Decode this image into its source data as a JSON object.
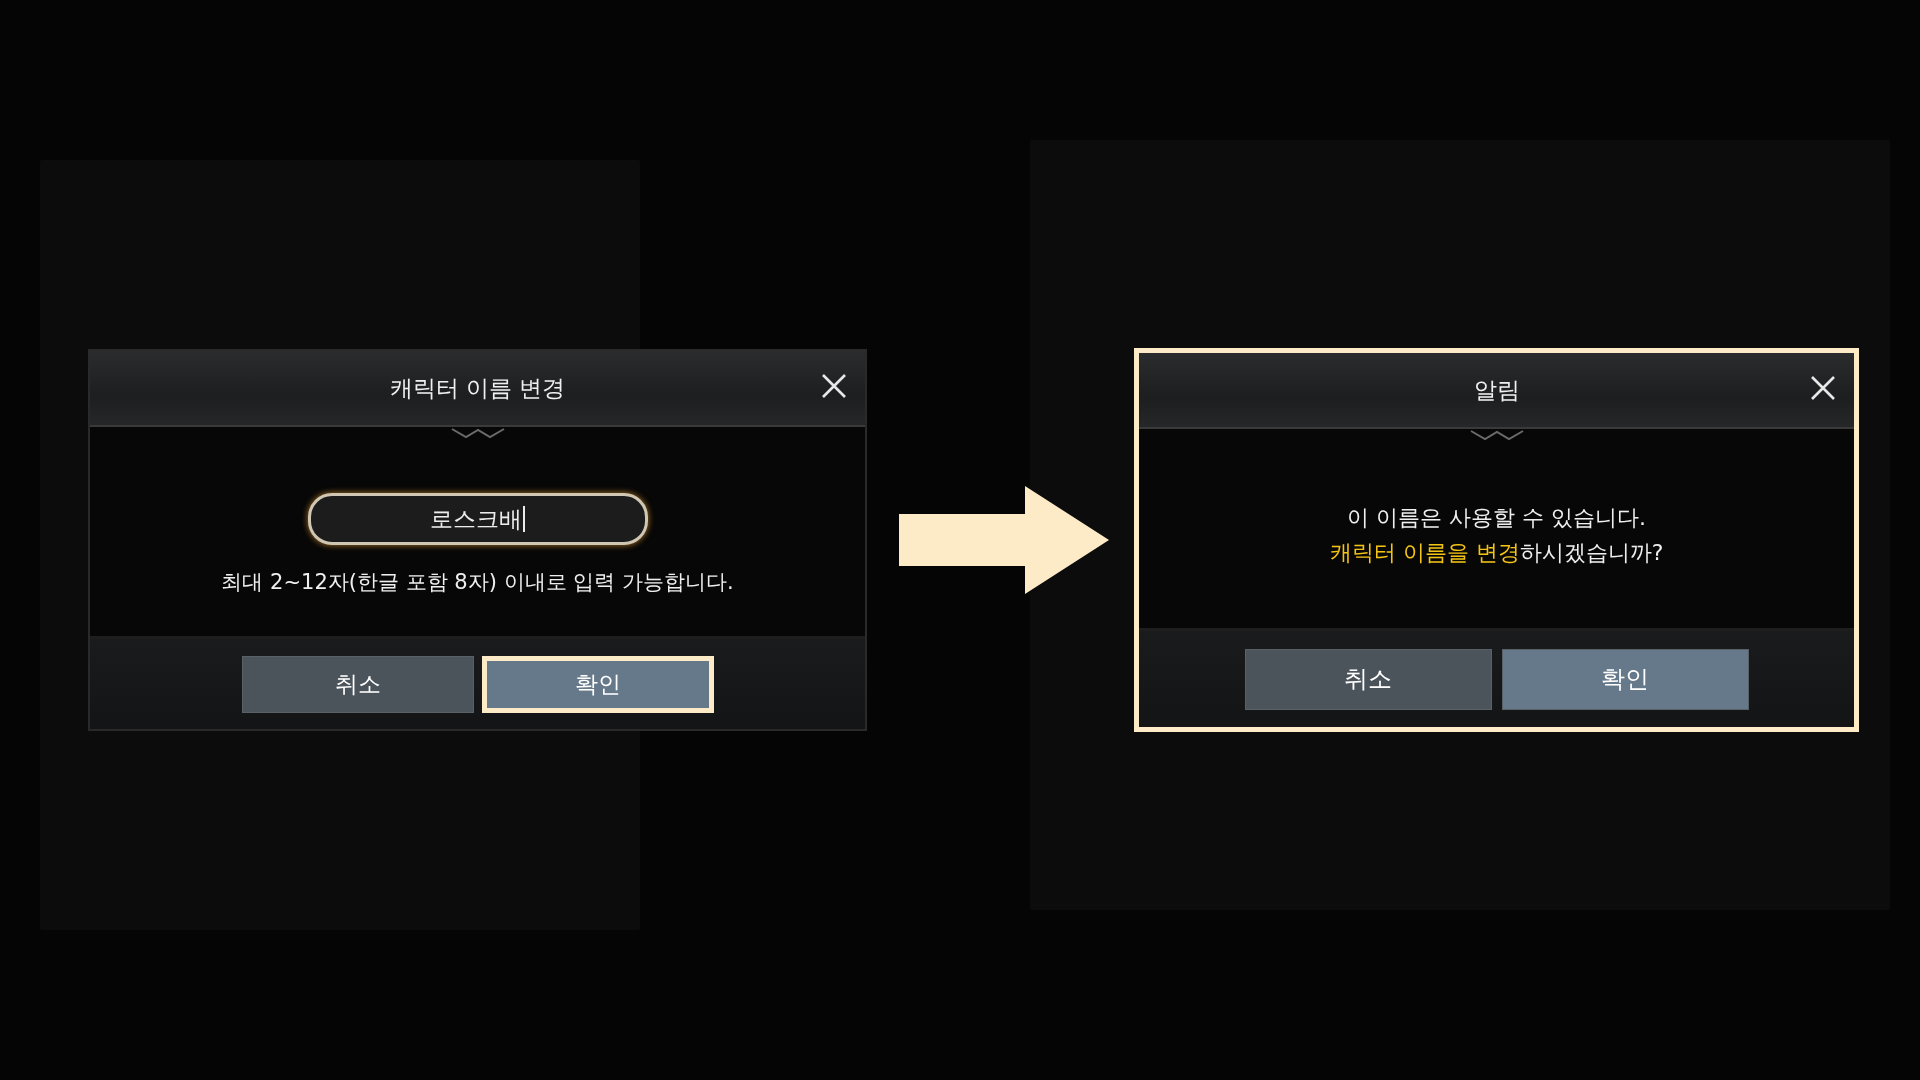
{
  "dialogs": [
    {
      "title": "캐릭터 이름 변경",
      "highlighted": false,
      "kind": "input",
      "field": {
        "value": "로스크배"
      },
      "message": [
        [
          {
            "text": "최대 2~12자(한글 포함 8자) 이내로 입력 가능합니다.",
            "highlight": false
          }
        ]
      ],
      "buttons": [
        {
          "label": "취소",
          "kind": "cancel",
          "highlighted": false
        },
        {
          "label": "확인",
          "kind": "confirm",
          "highlighted": true
        }
      ]
    },
    {
      "title": "알림",
      "highlighted": true,
      "kind": "notice",
      "message": [
        [
          {
            "text": "이 이름은 사용할 수 있습니다.",
            "highlight": false
          }
        ],
        [
          {
            "text": "캐릭터 이름을 변경",
            "highlight": true
          },
          {
            "text": "하시겠습니까?",
            "highlight": false
          }
        ]
      ],
      "buttons": [
        {
          "label": "취소",
          "kind": "cancel",
          "highlighted": false
        },
        {
          "label": "확인",
          "kind": "confirm",
          "highlighted": false
        }
      ]
    }
  ]
}
